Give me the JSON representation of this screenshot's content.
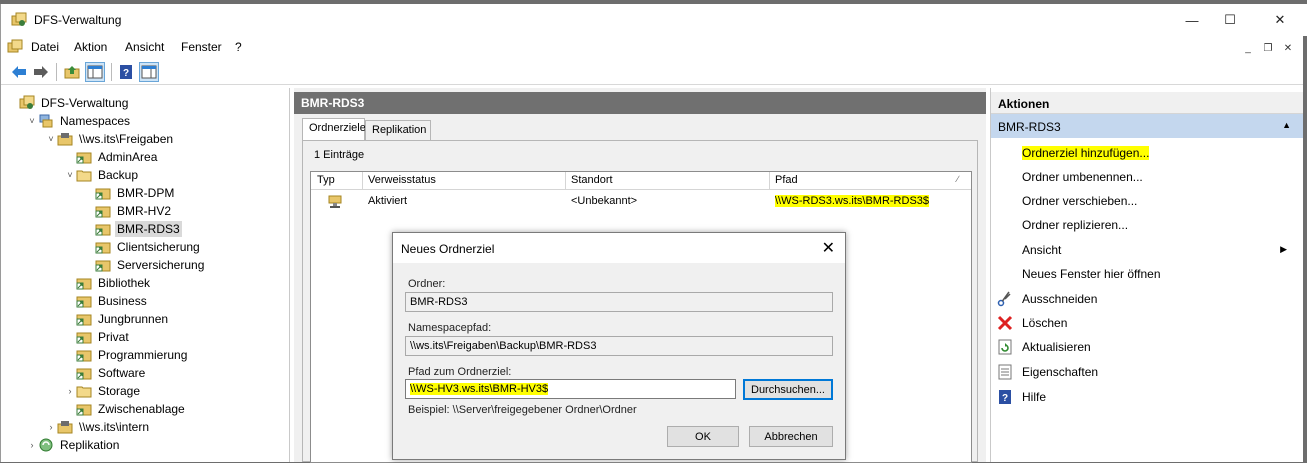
{
  "window": {
    "title": "DFS-Verwaltung"
  },
  "menu": [
    "Datei",
    "Aktion",
    "Ansicht",
    "Fenster",
    "?"
  ],
  "tree": [
    {
      "label": "DFS-Verwaltung",
      "level": 0,
      "exp": "",
      "icon": "dfs-icon"
    },
    {
      "label": "Namespaces",
      "level": 1,
      "exp": "v",
      "icon": "namespaces-icon"
    },
    {
      "label": "\\\\ws.its\\Freigaben",
      "level": 2,
      "exp": "v",
      "icon": "namespace-icon"
    },
    {
      "label": "AdminArea",
      "level": 3,
      "exp": "",
      "icon": "folder-link-icon"
    },
    {
      "label": "Backup",
      "level": 3,
      "exp": "v",
      "icon": "folder-icon"
    },
    {
      "label": "BMR-DPM",
      "level": 4,
      "exp": "",
      "icon": "folder-link-icon"
    },
    {
      "label": "BMR-HV2",
      "level": 4,
      "exp": "",
      "icon": "folder-link-icon"
    },
    {
      "label": "BMR-RDS3",
      "level": 4,
      "exp": "",
      "icon": "folder-link-icon",
      "selected": true
    },
    {
      "label": "Clientsicherung",
      "level": 4,
      "exp": "",
      "icon": "folder-link-icon"
    },
    {
      "label": "Serversicherung",
      "level": 4,
      "exp": "",
      "icon": "folder-link-icon"
    },
    {
      "label": "Bibliothek",
      "level": 3,
      "exp": "",
      "icon": "folder-link-icon"
    },
    {
      "label": "Business",
      "level": 3,
      "exp": "",
      "icon": "folder-link-icon"
    },
    {
      "label": "Jungbrunnen",
      "level": 3,
      "exp": "",
      "icon": "folder-link-icon"
    },
    {
      "label": "Privat",
      "level": 3,
      "exp": "",
      "icon": "folder-link-icon"
    },
    {
      "label": "Programmierung",
      "level": 3,
      "exp": "",
      "icon": "folder-link-icon"
    },
    {
      "label": "Software",
      "level": 3,
      "exp": "",
      "icon": "folder-link-icon"
    },
    {
      "label": "Storage",
      "level": 3,
      "exp": ">",
      "icon": "folder-icon"
    },
    {
      "label": "Zwischenablage",
      "level": 3,
      "exp": "",
      "icon": "folder-link-icon"
    },
    {
      "label": "\\\\ws.its\\intern",
      "level": 2,
      "exp": ">",
      "icon": "namespace-icon"
    },
    {
      "label": "Replikation",
      "level": 1,
      "exp": ">",
      "icon": "replication-icon"
    }
  ],
  "center": {
    "title": "BMR-RDS3",
    "tabs": [
      "Ordnerziele",
      "Replikation"
    ],
    "count": "1 Einträge",
    "columns": [
      "Typ",
      "Verweisstatus",
      "Standort",
      "Pfad"
    ],
    "rows": [
      {
        "status": "Aktiviert",
        "location": "<Unbekannt>",
        "path": "\\\\WS-RDS3.ws.its\\BMR-RDS3$"
      }
    ]
  },
  "dialog": {
    "title": "Neues Ordnerziel",
    "folder_label": "Ordner:",
    "folder_value": "BMR-RDS3",
    "ns_label": "Namespacepfad:",
    "ns_value": "\\\\ws.its\\Freigaben\\Backup\\BMR-RDS3",
    "target_label": "Pfad zum Ordnerziel:",
    "target_value": "\\\\WS-HV3.ws.its\\BMR-HV3$",
    "browse_label": "Durchsuchen...",
    "example": "Beispiel: \\\\Server\\freigegebener Ordner\\Ordner",
    "ok_label": "OK",
    "cancel_label": "Abbrechen"
  },
  "actions": {
    "title": "Aktionen",
    "section": "BMR-RDS3",
    "items": [
      {
        "label": "Ordnerziel hinzufügen...",
        "icon": "",
        "highlight": true
      },
      {
        "label": "Ordner umbenennen...",
        "icon": ""
      },
      {
        "label": "Ordner verschieben...",
        "icon": ""
      },
      {
        "label": "Ordner replizieren...",
        "icon": ""
      },
      {
        "label": "Ansicht",
        "icon": "",
        "submenu": true
      },
      {
        "label": "Neues Fenster hier öffnen",
        "icon": ""
      },
      {
        "label": "Ausschneiden",
        "icon": "scissors-icon"
      },
      {
        "label": "Löschen",
        "icon": "delete-icon"
      },
      {
        "label": "Aktualisieren",
        "icon": "refresh-icon"
      },
      {
        "label": "Eigenschaften",
        "icon": "properties-icon"
      },
      {
        "label": "Hilfe",
        "icon": "help-icon"
      }
    ]
  },
  "colors": {
    "highlight": "#ffff00",
    "selection": "#c4d7ee",
    "header": "#707070"
  }
}
